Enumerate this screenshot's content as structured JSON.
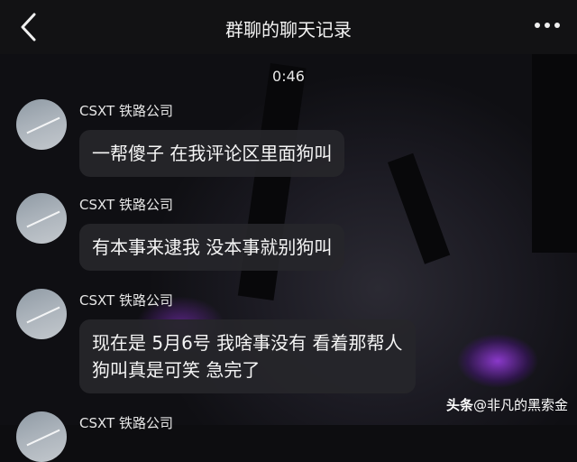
{
  "header": {
    "title": "群聊的聊天记录"
  },
  "timestamp": "0:46",
  "messages": [
    {
      "sender": "CSXT 铁路公司",
      "lines": [
        "一帮傻子 在我评论区里面狗叫"
      ]
    },
    {
      "sender": "CSXT 铁路公司",
      "lines": [
        "有本事来逮我 没本事就别狗叫"
      ]
    },
    {
      "sender": "CSXT 铁路公司",
      "lines": [
        "现在是 5月6号 我啥事没有 看着那帮人",
        "狗叫真是可笑 急完了"
      ]
    },
    {
      "sender": "CSXT 铁路公司",
      "lines": []
    }
  ],
  "watermark": {
    "brand": "头条",
    "handle": "@非凡的黑索金"
  },
  "colors": {
    "header_bg": "#121214",
    "bubble_bg": "#26262a",
    "accent_purple": "#963cdc"
  }
}
